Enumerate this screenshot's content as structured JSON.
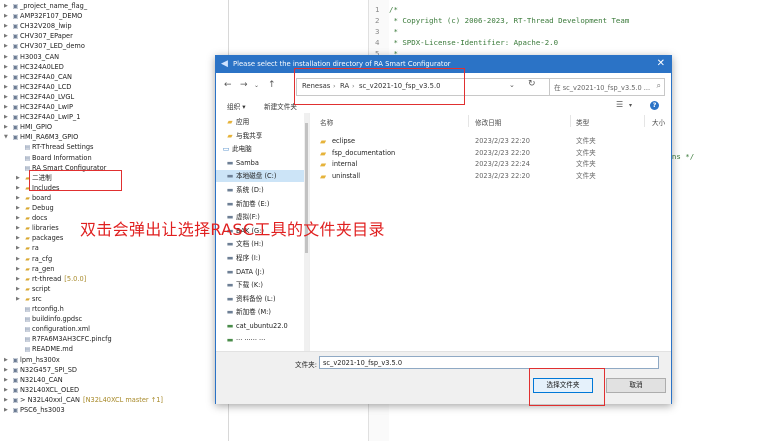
{
  "explorer": {
    "items": [
      {
        "label": "_project_name_flag_",
        "kind": "project",
        "indent": 0
      },
      {
        "label": "AMP32F107_DEMO",
        "kind": "project",
        "indent": 0
      },
      {
        "label": "CH32V208_lwip",
        "kind": "project",
        "indent": 0
      },
      {
        "label": "CHV307_EPaper",
        "kind": "project",
        "indent": 0
      },
      {
        "label": "CHV307_LED_demo",
        "kind": "project",
        "indent": 0
      },
      {
        "label": "H3003_CAN",
        "kind": "project",
        "indent": 0
      },
      {
        "label": "HC324A0LED",
        "kind": "project",
        "indent": 0
      },
      {
        "label": "HC32F4A0_CAN",
        "kind": "project",
        "indent": 0
      },
      {
        "label": "HC32F4A0_LCD",
        "kind": "project",
        "indent": 0
      },
      {
        "label": "HC32F4A0_LVGL",
        "kind": "project",
        "indent": 0
      },
      {
        "label": "HC32F4A0_LwIP",
        "kind": "project",
        "indent": 0
      },
      {
        "label": "HC32F4A0_LwIP_1",
        "kind": "project",
        "indent": 0
      },
      {
        "label": "HMI_GPIO",
        "kind": "project",
        "indent": 0
      },
      {
        "label": "HMI_RA6M3_GPIO",
        "kind": "project",
        "indent": 0,
        "expanded": true
      },
      {
        "label": "RT-Thread Settings",
        "kind": "file",
        "indent": 1
      },
      {
        "label": "Board Information",
        "kind": "file",
        "indent": 1
      },
      {
        "label": "RA Smart Configurator",
        "kind": "file",
        "indent": 1
      },
      {
        "label": "二进制",
        "kind": "folder",
        "indent": 1
      },
      {
        "label": "Includes",
        "kind": "folder",
        "indent": 1
      },
      {
        "label": "board",
        "kind": "folder",
        "indent": 1
      },
      {
        "label": "Debug",
        "kind": "folder",
        "indent": 1
      },
      {
        "label": "docs",
        "kind": "folder",
        "indent": 1
      },
      {
        "label": "libraries",
        "kind": "folder",
        "indent": 1
      },
      {
        "label": "packages",
        "kind": "folder",
        "indent": 1
      },
      {
        "label": "ra",
        "kind": "folder",
        "indent": 1
      },
      {
        "label": "ra_cfg",
        "kind": "folder",
        "indent": 1
      },
      {
        "label": "ra_gen",
        "kind": "folder",
        "indent": 1
      },
      {
        "label": "rt-thread",
        "tag": "[5.0.0]",
        "kind": "folder",
        "indent": 1
      },
      {
        "label": "script",
        "kind": "folder",
        "indent": 1
      },
      {
        "label": "src",
        "kind": "folder",
        "indent": 1
      },
      {
        "label": "rtconfig.h",
        "kind": "file",
        "indent": 1
      },
      {
        "label": "buildinfo.gpdsc",
        "kind": "file",
        "indent": 1
      },
      {
        "label": "configuration.xml",
        "kind": "file",
        "indent": 1
      },
      {
        "label": "R7FA6M3AH3CFC.pincfg",
        "kind": "file",
        "indent": 1
      },
      {
        "label": "README.md",
        "kind": "file",
        "indent": 1
      },
      {
        "label": "lpm_hs300x",
        "kind": "project",
        "indent": 0
      },
      {
        "label": "N32G457_SPI_SD",
        "kind": "project",
        "indent": 0
      },
      {
        "label": "N32L40_CAN",
        "kind": "project",
        "indent": 0
      },
      {
        "label": "N32L40XCL_OLED",
        "kind": "project",
        "indent": 0
      },
      {
        "label": "> N32L40xxl_CAN",
        "tag": "[N32L40XCL master ↑1]",
        "kind": "project",
        "indent": 0
      },
      {
        "label": "PSC6_hs3003",
        "kind": "project",
        "indent": 0
      }
    ]
  },
  "editor": {
    "lines": [
      {
        "num": "1",
        "text": "/*"
      },
      {
        "num": "2",
        "text": " * Copyright (c) 2006-2023, RT-Thread Development Team"
      },
      {
        "num": "3",
        "text": " *"
      },
      {
        "num": "4",
        "text": " * SPDX-License-Identifier: Apache-2.0"
      },
      {
        "num": "5",
        "text": " *"
      }
    ],
    "fragment": "pins */"
  },
  "dialog": {
    "title": "Please select the installation directory of RA Smart Configurator",
    "address": [
      "Renesas",
      "RA",
      "sc_v2021-10_fsp_v3.5.0"
    ],
    "search_placeholder": "在 sc_v2021-10_fsp_v3.5.0 ...",
    "toolbar": {
      "organize": "组织 ▾",
      "new_folder": "新建文件夹"
    },
    "nav_items": [
      {
        "label": "应用",
        "icon": "folder"
      },
      {
        "label": "与我共享",
        "icon": "folder"
      },
      {
        "label": "此电脑",
        "icon": "pc"
      },
      {
        "label": "Samba",
        "icon": "drive"
      },
      {
        "label": "本地磁盘 (C:)",
        "icon": "drive",
        "selected": true
      },
      {
        "label": "系统 (D:)",
        "icon": "drive"
      },
      {
        "label": "新加卷 (E:)",
        "icon": "drive"
      },
      {
        "label": "虚拟(F:)",
        "icon": "drive"
      },
      {
        "label": "BAK (G:)",
        "icon": "drive"
      },
      {
        "label": "文档 (H:)",
        "icon": "drive"
      },
      {
        "label": "程序 (I:)",
        "icon": "drive"
      },
      {
        "label": "DATA (J:)",
        "icon": "drive"
      },
      {
        "label": "下载 (K:)",
        "icon": "drive"
      },
      {
        "label": "资料备份 (L:)",
        "icon": "drive"
      },
      {
        "label": "新加卷 (M:)",
        "icon": "drive"
      },
      {
        "label": "cat_ubuntu22.0",
        "icon": "net"
      },
      {
        "label": "··· ······ ···",
        "icon": "net"
      }
    ],
    "columns": {
      "name": "名称",
      "date": "修改日期",
      "type": "类型",
      "size": "大小"
    },
    "files": [
      {
        "name": "eclipse",
        "date": "2023/2/23 22:20",
        "type": "文件夹"
      },
      {
        "name": "fsp_documentation",
        "date": "2023/2/23 22:20",
        "type": "文件夹"
      },
      {
        "name": "internal",
        "date": "2023/2/23 22:24",
        "type": "文件夹"
      },
      {
        "name": "uninstall",
        "date": "2023/2/23 22:20",
        "type": "文件夹"
      }
    ],
    "folder_label": "文件夹:",
    "folder_value": "sc_v2021-10_fsp_v3.5.0",
    "select_button": "选择文件夹",
    "cancel_button": "取消"
  },
  "annotation": "双击会弹出让选择RASC工具的文件夹目录",
  "colors": {
    "accent": "#2b73c6",
    "annotation": "#e02020",
    "folder": "#e6b33a"
  }
}
